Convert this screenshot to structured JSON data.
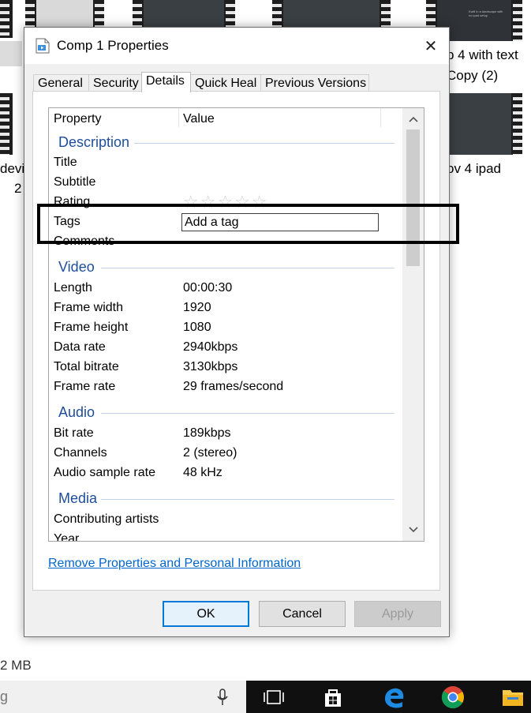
{
  "background": {
    "labels": {
      "top_right_1": "p 4 with text",
      "top_right_2": "Copy (2)",
      "left_1": "devi",
      "left_2": "2",
      "right_mid": "ov 4 ipad",
      "size": "2 MB"
    },
    "thumb_text": "Kwill in a landscape with\nno ipad setup"
  },
  "dialog": {
    "title": "Comp 1 Properties",
    "close_label": "✕",
    "tabs": [
      "General",
      "Security",
      "Details",
      "Quick Heal",
      "Previous Versions"
    ],
    "active_tab": "Details",
    "columns": {
      "property": "Property",
      "value": "Value"
    },
    "groups": {
      "description": "Description",
      "video": "Video",
      "audio": "Audio",
      "media": "Media"
    },
    "description_rows": [
      {
        "name": "Title",
        "value": ""
      },
      {
        "name": "Subtitle",
        "value": ""
      },
      {
        "name": "Rating",
        "value": "☆☆☆☆☆"
      },
      {
        "name": "Tags",
        "value": "Add a tag"
      },
      {
        "name": "Comments",
        "value": ""
      }
    ],
    "video_rows": [
      {
        "name": "Length",
        "value": "00:00:30"
      },
      {
        "name": "Frame width",
        "value": "1920"
      },
      {
        "name": "Frame height",
        "value": "1080"
      },
      {
        "name": "Data rate",
        "value": "2940kbps"
      },
      {
        "name": "Total bitrate",
        "value": "3130kbps"
      },
      {
        "name": "Frame rate",
        "value": "29 frames/second"
      }
    ],
    "audio_rows": [
      {
        "name": "Bit rate",
        "value": "189kbps"
      },
      {
        "name": "Channels",
        "value": "2 (stereo)"
      },
      {
        "name": "Audio sample rate",
        "value": "48 kHz"
      }
    ],
    "media_rows": [
      {
        "name": "Contributing artists",
        "value": ""
      },
      {
        "name": "Year",
        "value": ""
      }
    ],
    "remove_link": "Remove Properties and Personal Information",
    "buttons": {
      "ok": "OK",
      "cancel": "Cancel",
      "apply": "Apply"
    }
  },
  "taskbar": {
    "search_text": "g",
    "icons": [
      "microphone-icon",
      "task-view-icon",
      "store-icon",
      "edge-icon",
      "chrome-icon",
      "file-explorer-icon"
    ]
  },
  "colors": {
    "group_header": "#1e4e9a",
    "link": "#0066cc",
    "ok_border": "#0078d7",
    "taskbar": "#101010"
  }
}
